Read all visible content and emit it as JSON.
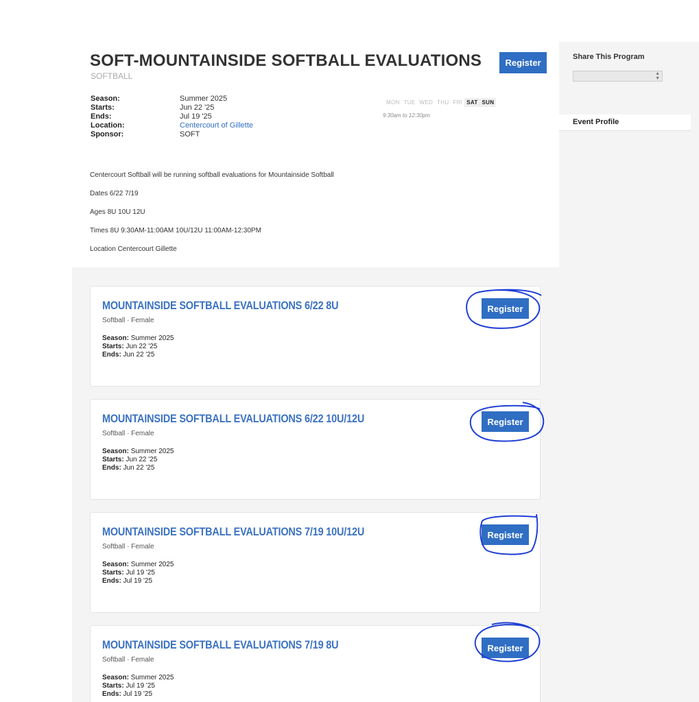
{
  "program": {
    "title": "SOFT-MOUNTAINSIDE SOFTBALL EVALUATIONS",
    "subtitle": "SOFTBALL",
    "register_label": "Register",
    "details": [
      {
        "label": "Season:",
        "value": "Summer 2025"
      },
      {
        "label": "Starts:",
        "value": "Jun 22 '25"
      },
      {
        "label": "Ends:",
        "value": "Jul 19 '25"
      },
      {
        "label": "Location:",
        "value": "Centercourt of Gillette"
      },
      {
        "label": "Sponsor:",
        "value": "SOFT"
      }
    ],
    "days": [
      "MON",
      "TUE",
      "WED",
      "THU",
      "FRI",
      "SAT",
      "SUN"
    ],
    "active_days": [
      "SAT",
      "SUN"
    ],
    "time_range": "9:30am to 12:30pm",
    "description": [
      "Centercourt Softball will be running softball evaluations for Mountainside Softball",
      "Dates 6/22 7/19",
      "Ages 8U 10U 12U",
      "Times 8U 9:30AM-11:00AM 10U/12U 11:00AM-12:30PM",
      "Location Centercourt Gillette"
    ]
  },
  "events": [
    {
      "title": "MOUNTAINSIDE SOFTBALL EVALUATIONS 6/22 8U",
      "subtitle": "Softball · Female",
      "season_label": "Season:",
      "season": "Summer 2025",
      "starts_label": "Starts:",
      "starts": "Jun 22 '25",
      "ends_label": "Ends:",
      "ends": "Jun 22 '25",
      "register_label": "Register"
    },
    {
      "title": "MOUNTAINSIDE SOFTBALL EVALUATIONS 6/22 10U/12U",
      "subtitle": "Softball · Female",
      "season_label": "Season:",
      "season": "Summer 2025",
      "starts_label": "Starts:",
      "starts": "Jun 22 '25",
      "ends_label": "Ends:",
      "ends": "Jun 22 '25",
      "register_label": "Register"
    },
    {
      "title": "MOUNTAINSIDE SOFTBALL EVALUATIONS 7/19 10U/12U",
      "subtitle": "Softball · Female",
      "season_label": "Season:",
      "season": "Summer 2025",
      "starts_label": "Starts:",
      "starts": "Jul 19 '25",
      "ends_label": "Ends:",
      "ends": "Jul 19 '25",
      "register_label": "Register"
    },
    {
      "title": "MOUNTAINSIDE SOFTBALL EVALUATIONS 7/19 8U",
      "subtitle": "Softball · Female",
      "season_label": "Season:",
      "season": "Summer 2025",
      "starts_label": "Starts:",
      "starts": "Jul 19 '25",
      "ends_label": "Ends:",
      "ends": "Jul 19 '25",
      "register_label": "Register"
    }
  ],
  "sidebar": {
    "share_title": "Share This Program",
    "select_icon": "up-down-chevron-icon",
    "tab_label": "Event Profile"
  },
  "colors": {
    "accent": "#2f6ec3",
    "annotation": "#1f3fd6"
  }
}
